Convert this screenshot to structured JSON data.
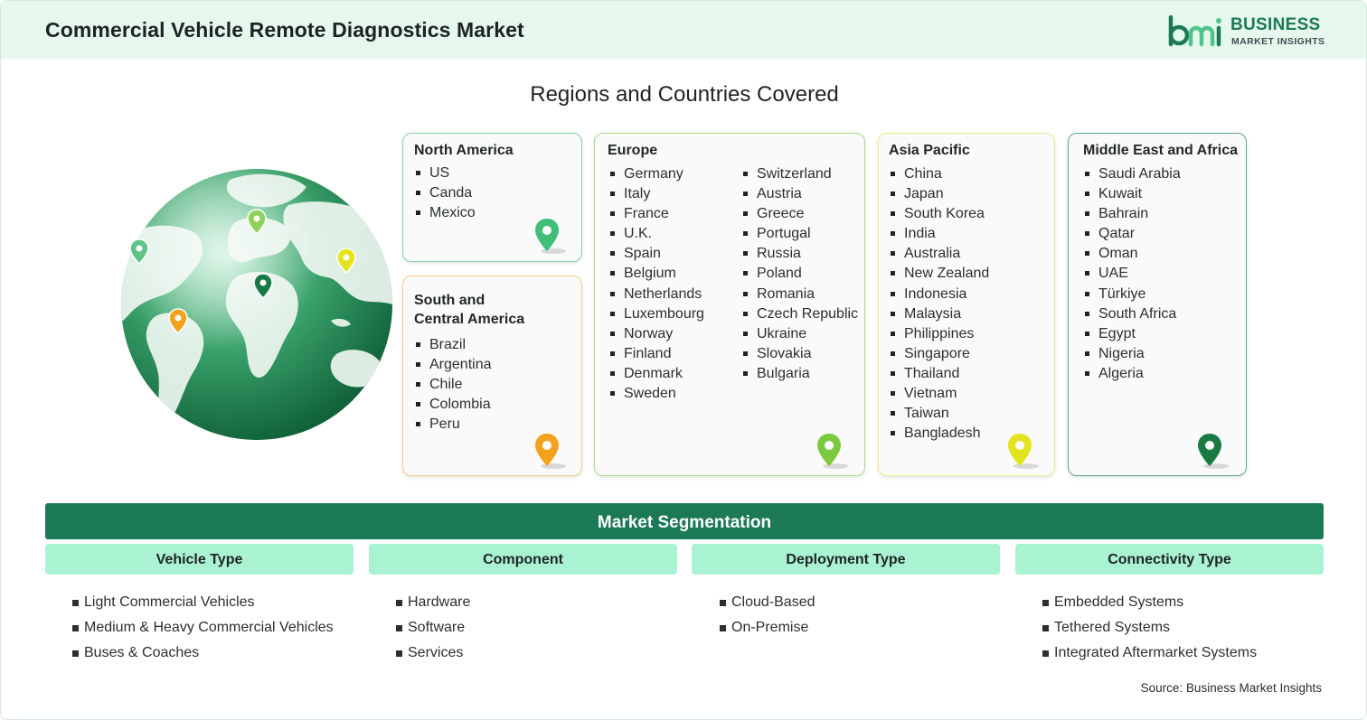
{
  "header": {
    "title": "Commercial Vehicle Remote Diagnostics Market"
  },
  "logo": {
    "mark": "bmi",
    "line1": "BUSINESS",
    "line2": "MARKET INSIGHTS",
    "icon": "bmi-logo-icon"
  },
  "regions_title": "Regions and Countries Covered",
  "regions": {
    "north_america": {
      "name": "North America",
      "countries": [
        "US",
        "Canda",
        "Mexico"
      ],
      "pin_color": "#3fbf78"
    },
    "south_america": {
      "name_line1": "South and",
      "name_line2": "Central America",
      "countries": [
        "Brazil",
        "Argentina",
        "Chile",
        "Colombia",
        "Peru"
      ],
      "pin_color": "#f4a21d"
    },
    "europe": {
      "name": "Europe",
      "col1": [
        "Germany",
        "Italy",
        "France",
        "U.K.",
        "Spain",
        "Belgium",
        "Netherlands",
        "Luxembourg",
        "Norway",
        "Finland",
        "Denmark",
        "Sweden"
      ],
      "col2": [
        "Switzerland",
        "Austria",
        "Greece",
        "Portugal",
        "Russia",
        "Poland",
        "Romania",
        "Czech Republic",
        "Ukraine",
        "Slovakia",
        "Bulgaria"
      ],
      "pin_color": "#7cc940"
    },
    "asia_pacific": {
      "name": "Asia Pacific",
      "countries": [
        "China",
        "Japan",
        "South Korea",
        "India",
        "Australia",
        "New Zealand",
        "Indonesia",
        "Malaysia",
        "Philippines",
        "Singapore",
        "Thailand",
        "Vietnam",
        "Taiwan",
        "Bangladesh"
      ],
      "pin_color": "#e4e41c"
    },
    "middle_east_africa": {
      "name": "Middle East and Africa",
      "countries": [
        "Saudi Arabia",
        "Kuwait",
        "Bahrain",
        "Qatar",
        "Oman",
        "UAE",
        "Türkiye",
        "South Africa",
        "Egypt",
        "Nigeria",
        "Algeria"
      ],
      "pin_color": "#1a7a44"
    }
  },
  "segmentation": {
    "title": "Market Segmentation",
    "columns": [
      {
        "heading": "Vehicle Type",
        "items": [
          "Light Commercial Vehicles",
          "Medium & Heavy Commercial Vehicles",
          "Buses & Coaches"
        ]
      },
      {
        "heading": "Component",
        "items": [
          "Hardware",
          "Software",
          "Services"
        ]
      },
      {
        "heading": "Deployment Type",
        "items": [
          "Cloud-Based",
          "On-Premise"
        ]
      },
      {
        "heading": "Connectivity Type",
        "items": [
          "Embedded Systems",
          "Tethered Systems",
          "Integrated Aftermarket Systems"
        ]
      }
    ]
  },
  "source": "Source: Business Market Insights",
  "colors": {
    "brand_green": "#1b7a55",
    "header_bg": "#e6f7ee",
    "segment_head_bg": "#a9f2d2"
  }
}
